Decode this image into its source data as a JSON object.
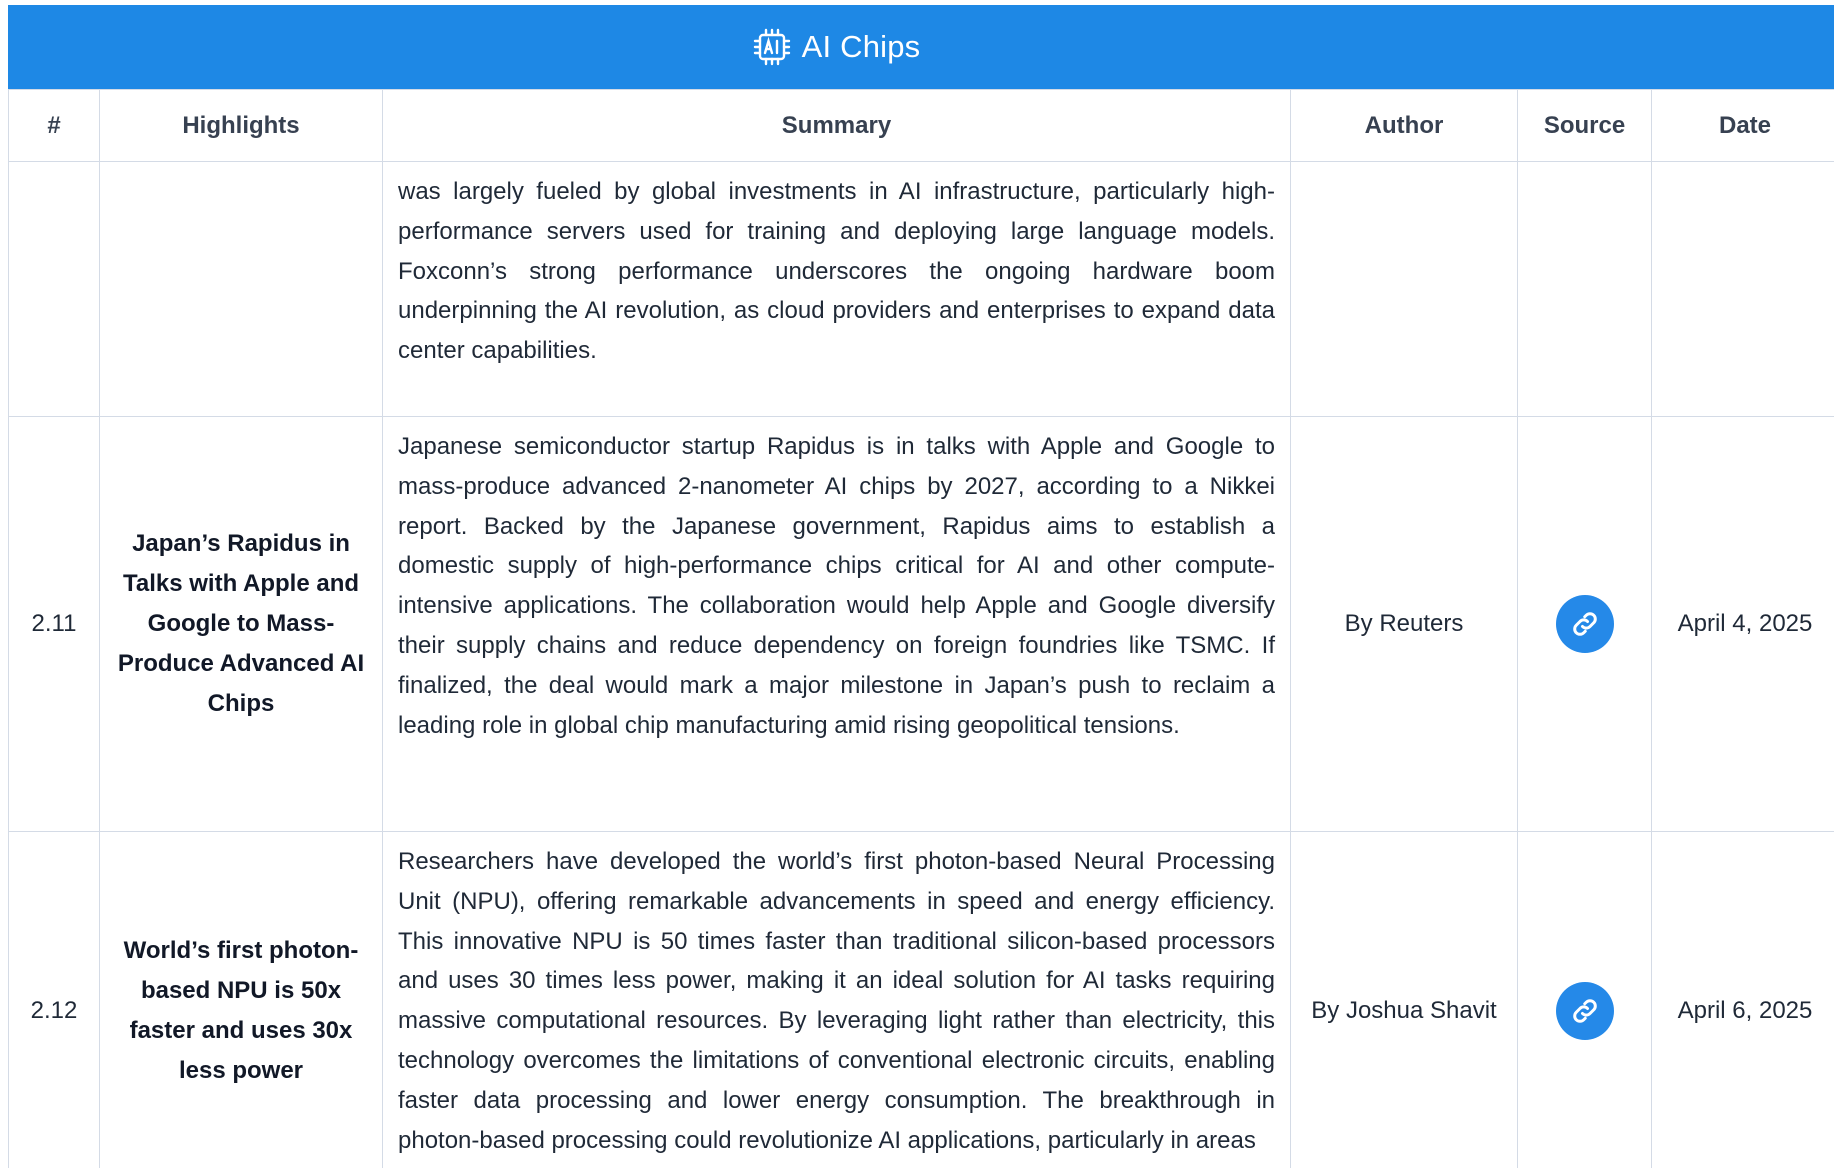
{
  "header": {
    "title": "AI Chips",
    "icon": "ai-chip-icon",
    "background_color": "#1e88e5"
  },
  "table": {
    "columns": [
      "#",
      "Highlights",
      "Summary",
      "Author",
      "Source",
      "Date"
    ],
    "rows": [
      {
        "num": "",
        "highlight": "",
        "summary": "was largely fueled by global investments in AI infrastructure, particularly high-performance servers used for training and deploying large language models. Foxconn’s strong performance underscores the ongoing hardware boom underpinning the AI revolution, as cloud providers and enterprises to expand data center capabilities.",
        "author": "",
        "source_icon": "",
        "date": ""
      },
      {
        "num": "2.11",
        "highlight": "Japan’s Rapidus in Talks with Apple and Google to Mass-Produce Advanced AI Chips",
        "summary": "Japanese semiconductor startup Rapidus is in talks with Apple and Google to mass-produce advanced 2-nanometer AI chips by 2027, according to a Nikkei report. Backed by the Japanese government, Rapidus aims to establish a domestic supply of high-performance chips critical for AI and other compute-intensive applications. The collaboration would help Apple and Google diversify their supply chains and reduce dependency on foreign foundries like TSMC. If finalized, the deal would mark a major milestone in Japan’s push to reclaim a leading role in global chip manufacturing amid rising geopolitical tensions.",
        "author": "By Reuters",
        "source_icon": "link-icon",
        "date": "April 4, 2025"
      },
      {
        "num": "2.12",
        "highlight": "World’s first photon-based NPU is 50x faster and uses 30x less power",
        "summary": "Researchers have developed the world’s first photon-based Neural Processing Unit (NPU), offering remarkable advancements in speed and energy efficiency. This innovative NPU is 50 times faster than traditional silicon-based processors and uses 30 times less power, making it an ideal solution for AI tasks requiring massive computational resources. By leveraging light rather than electricity, this technology overcomes the limitations of conventional electronic circuits, enabling faster data processing and lower energy consumption. The breakthrough in photon-based processing could revolutionize AI applications, particularly in areas",
        "author": "By Joshua Shavit",
        "source_icon": "link-icon",
        "date": "April 6, 2025"
      }
    ]
  },
  "colors": {
    "accent": "#1e88e5",
    "link_button": "#2589e8",
    "border": "#d4dbe6"
  }
}
